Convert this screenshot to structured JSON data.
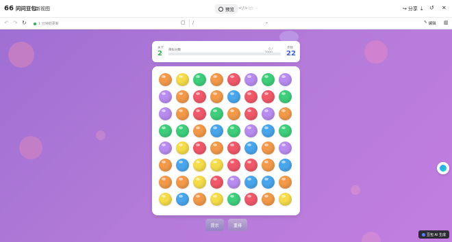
{
  "app": {
    "brand_name": "问问豆包",
    "new_chat": "新视图"
  },
  "toolbar": {
    "preview_label": "预览",
    "share_label": "分享"
  },
  "address": {
    "status": "1 分钟前更新",
    "url": "/"
  },
  "sidebar": {
    "edit_label": "编辑"
  },
  "game": {
    "level_label": "关卡",
    "level": "2",
    "target_label": "目标分数",
    "progress_text": "0 / 2000",
    "progress_fraction": 0.0,
    "moves_label": "步数",
    "moves": "22",
    "hint_label": "提示",
    "reset_label": "重排",
    "colors": {
      "orange": "#f39a4a",
      "yellow": "#f5dc4a",
      "green": "#3fcf7c",
      "red": "#f0596a",
      "purple": "#b98cf0",
      "blue": "#4aa6ec"
    },
    "grid": [
      [
        "orange",
        "yellow",
        "green",
        "orange",
        "red",
        "purple",
        "green",
        "purple"
      ],
      [
        "purple",
        "orange",
        "red",
        "orange",
        "blue",
        "red",
        "red",
        "green"
      ],
      [
        "purple",
        "orange",
        "red",
        "green",
        "orange",
        "red",
        "purple",
        "orange"
      ],
      [
        "green",
        "green",
        "orange",
        "blue",
        "green",
        "purple",
        "blue",
        "green"
      ],
      [
        "purple",
        "yellow",
        "red",
        "orange",
        "red",
        "blue",
        "orange",
        "purple"
      ],
      [
        "orange",
        "blue",
        "yellow",
        "yellow",
        "red",
        "red",
        "orange",
        "blue"
      ],
      [
        "orange",
        "orange",
        "yellow",
        "red",
        "purple",
        "blue",
        "blue",
        "orange"
      ],
      [
        "yellow",
        "blue",
        "orange",
        "yellow",
        "green",
        "red",
        "orange",
        "yellow"
      ]
    ]
  },
  "badge": {
    "ai_label": "豆包 AI 生成"
  }
}
